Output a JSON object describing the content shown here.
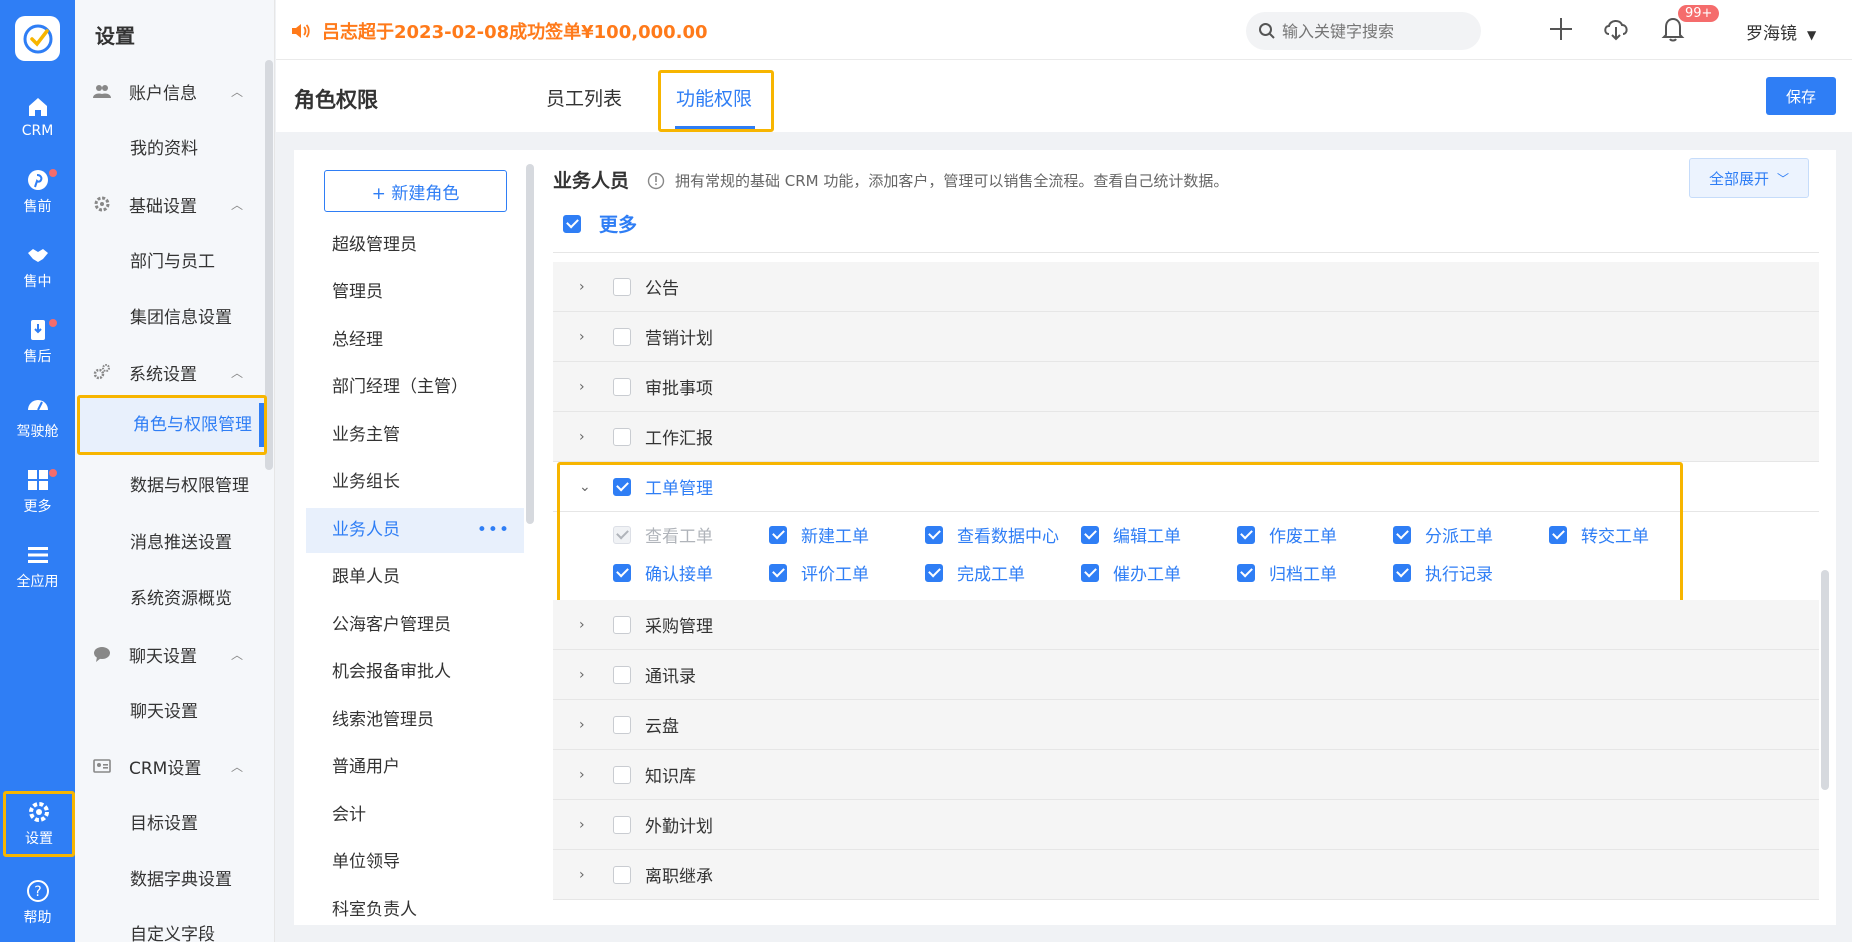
{
  "rail": {
    "items": [
      {
        "label": "CRM",
        "icon": "home-icon"
      },
      {
        "label": "售前",
        "icon": "pinterest-icon"
      },
      {
        "label": "售中",
        "icon": "handshake-icon"
      },
      {
        "label": "售后",
        "icon": "award-icon"
      },
      {
        "label": "驾驶舱",
        "icon": "dashboard-icon"
      },
      {
        "label": "更多",
        "icon": "grid-icon"
      },
      {
        "label": "全应用",
        "icon": "menu-icon"
      },
      {
        "label": "设置",
        "icon": "gear-icon"
      },
      {
        "label": "帮助",
        "icon": "help-icon"
      }
    ]
  },
  "sidebar": {
    "title": "设置",
    "groups": [
      {
        "label": "账户信息",
        "items": [
          "我的资料"
        ]
      },
      {
        "label": "基础设置",
        "items": [
          "部门与员工",
          "集团信息设置"
        ]
      },
      {
        "label": "系统设置",
        "items": [
          "角色与权限管理",
          "数据与权限管理",
          "消息推送设置",
          "系统资源概览"
        ]
      },
      {
        "label": "聊天设置",
        "items": [
          "聊天设置"
        ]
      },
      {
        "label": "CRM设置",
        "items": [
          "目标设置",
          "数据字典设置",
          "自定义字段"
        ]
      }
    ]
  },
  "header": {
    "notice": "吕志超于2023-02-08成功签单¥100,000.00",
    "search_placeholder": "输入关键字搜索",
    "badge": "99+",
    "user": "罗海镜"
  },
  "page": {
    "title": "角色权限",
    "tabs": [
      "员工列表",
      "功能权限"
    ],
    "save_label": "保存"
  },
  "roles": {
    "new_label": "+ 新建角色",
    "list": [
      "超级管理员",
      "管理员",
      "总经理",
      "部门经理（主管）",
      "业务主管",
      "业务组长",
      "业务人员",
      "跟单人员",
      "公海客户管理员",
      "机会报备审批人",
      "线索池管理员",
      "普通用户",
      "会计",
      "单位领导",
      "科室负责人"
    ],
    "active": "业务人员"
  },
  "perm": {
    "title": "业务人员",
    "desc": "拥有常规的基础 CRM 功能，添加客户，管理可以销售全流程。查看自己统计数据。",
    "expand_label": "全部展开",
    "more_label": "更多",
    "modules_top": [
      "公告",
      "营销计划",
      "审批事项",
      "工作汇报"
    ],
    "open_module": "工单管理",
    "sub_perms": [
      "查看工单",
      "新建工单",
      "查看数据中心",
      "编辑工单",
      "作废工单",
      "分派工单",
      "转交工单",
      "确认接单",
      "评价工单",
      "完成工单",
      "催办工单",
      "归档工单",
      "执行记录"
    ],
    "modules_bottom": [
      "采购管理",
      "通讯录",
      "云盘",
      "知识库",
      "外勤计划",
      "离职继承"
    ]
  }
}
